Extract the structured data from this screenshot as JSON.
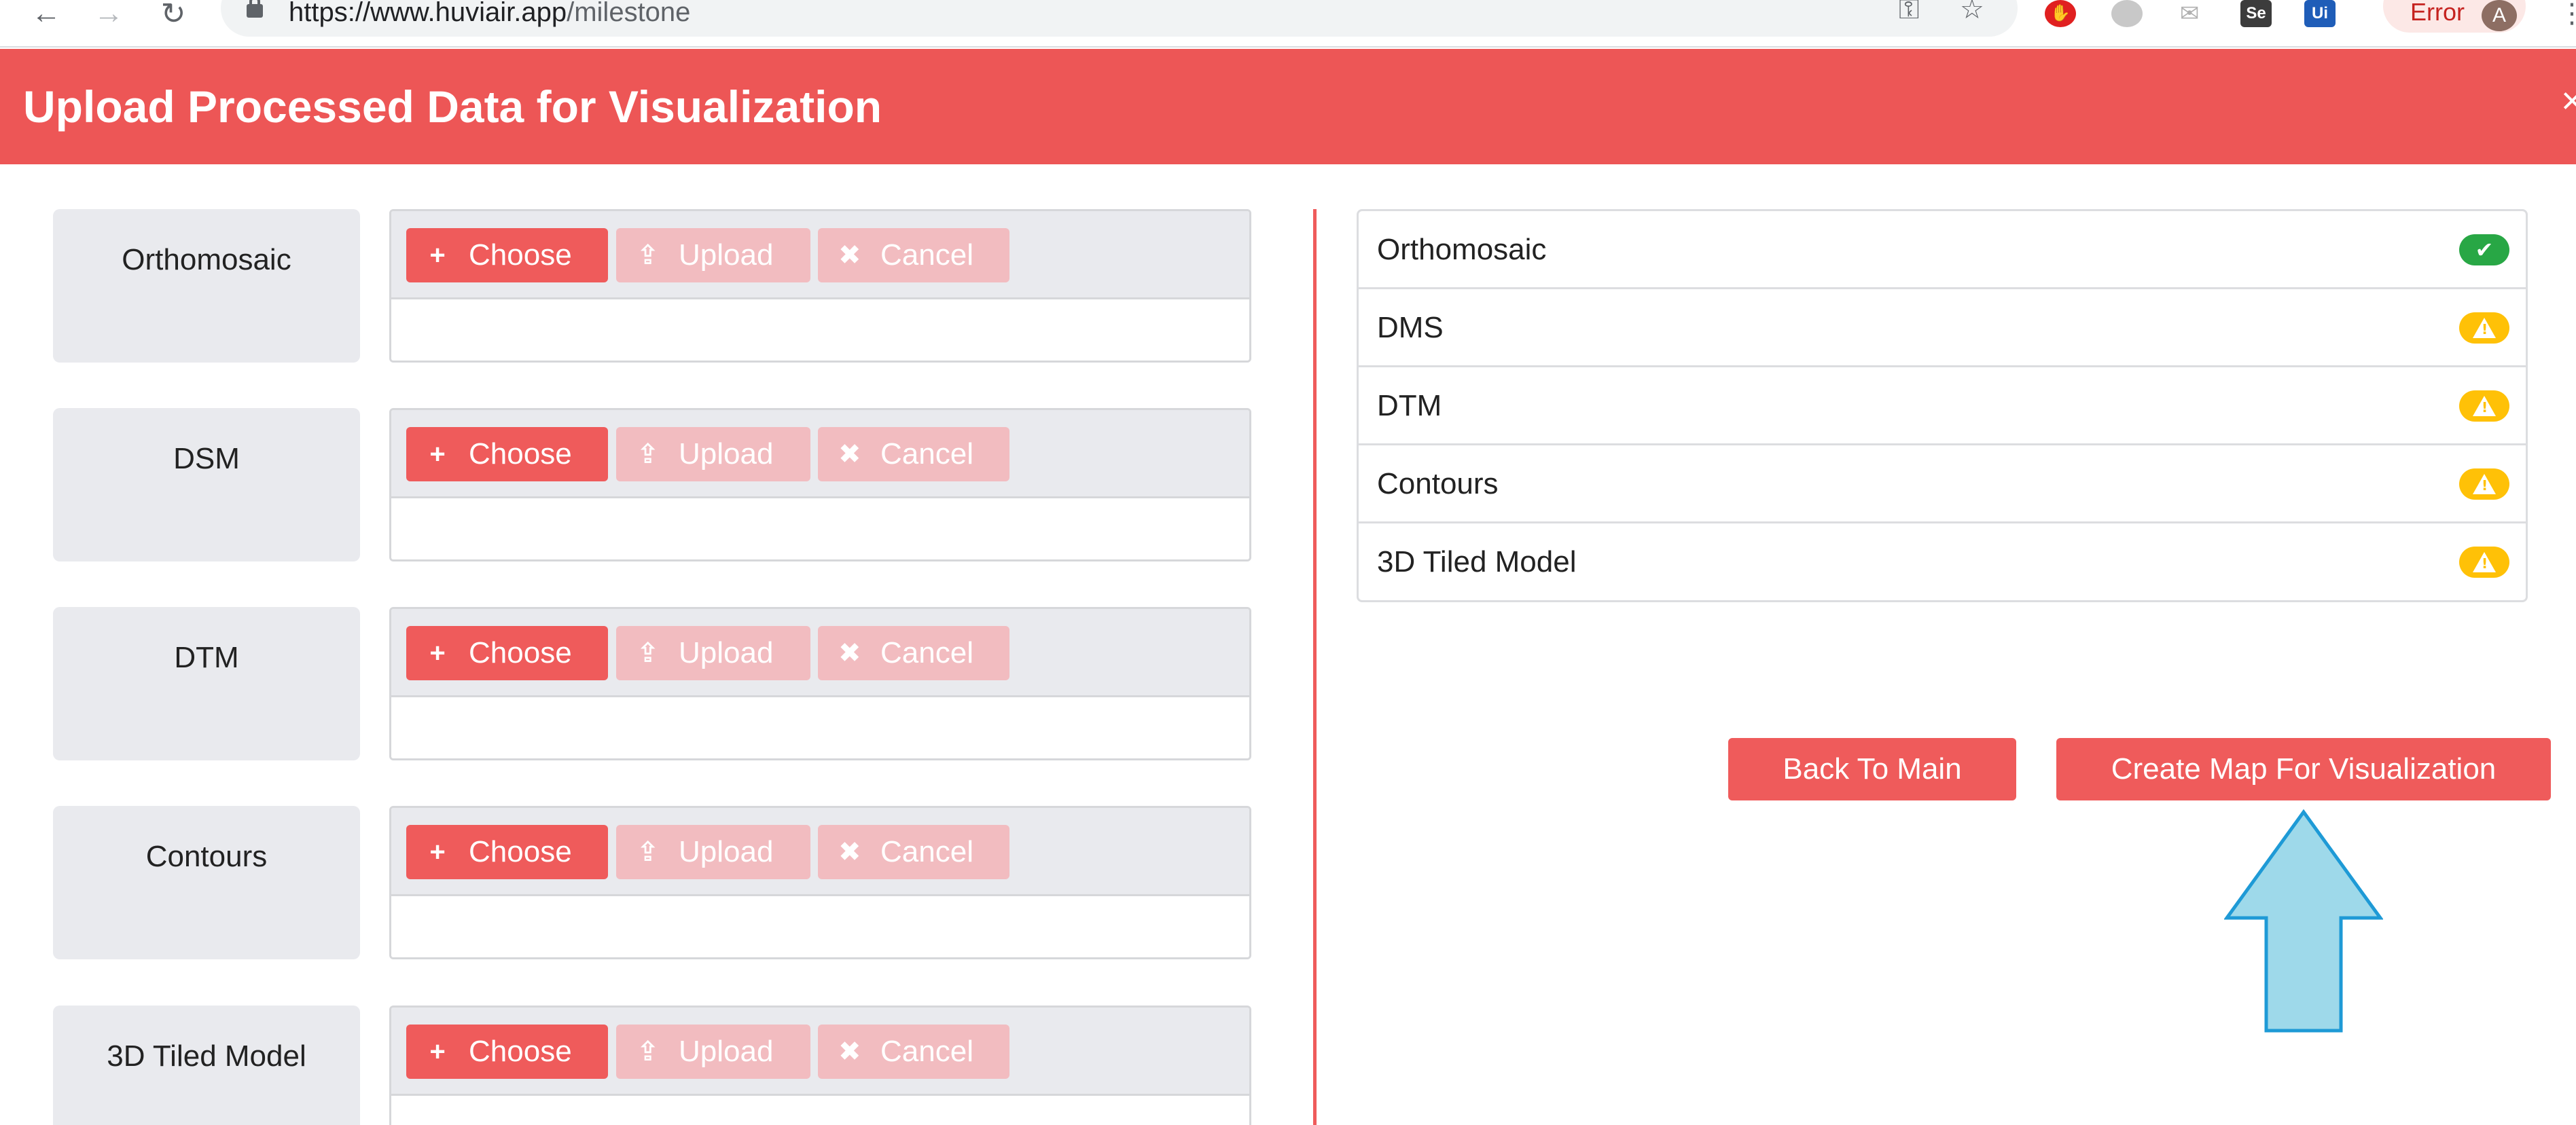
{
  "browser": {
    "url_domain": "https://www.huviair.app",
    "url_path": "/milestone",
    "error_label": "Error",
    "avatar_initial": "A",
    "ext_se": "Se",
    "ext_ui": "Ui"
  },
  "modal": {
    "title": "Upload Processed Data for Visualization",
    "close": "×"
  },
  "upload_rows": [
    {
      "label": "Orthomosaic",
      "choose": "Choose",
      "upload": "Upload",
      "cancel": "Cancel"
    },
    {
      "label": "DSM",
      "choose": "Choose",
      "upload": "Upload",
      "cancel": "Cancel"
    },
    {
      "label": "DTM",
      "choose": "Choose",
      "upload": "Upload",
      "cancel": "Cancel"
    },
    {
      "label": "Contours",
      "choose": "Choose",
      "upload": "Upload",
      "cancel": "Cancel"
    },
    {
      "label": "3D Tiled Model",
      "choose": "Choose",
      "upload": "Upload",
      "cancel": "Cancel"
    }
  ],
  "status_list": [
    {
      "label": "Orthomosaic",
      "status": "complete",
      "icon": "check-icon"
    },
    {
      "label": "DMS",
      "status": "warning",
      "icon": "warning-icon"
    },
    {
      "label": "DTM",
      "status": "warning",
      "icon": "warning-icon"
    },
    {
      "label": "Contours",
      "status": "warning",
      "icon": "warning-icon"
    },
    {
      "label": "3D Tiled Model",
      "status": "warning",
      "icon": "warning-icon"
    }
  ],
  "actions": {
    "back": "Back To Main",
    "create": "Create Map For Visualization"
  },
  "colors": {
    "accent": "#ed5656",
    "disabled_button": "#f2bcc0",
    "success": "#28a745",
    "warning": "#ffc107",
    "annotation_arrow_fill": "#9ed9ea",
    "annotation_arrow_stroke": "#1e9ad6"
  }
}
